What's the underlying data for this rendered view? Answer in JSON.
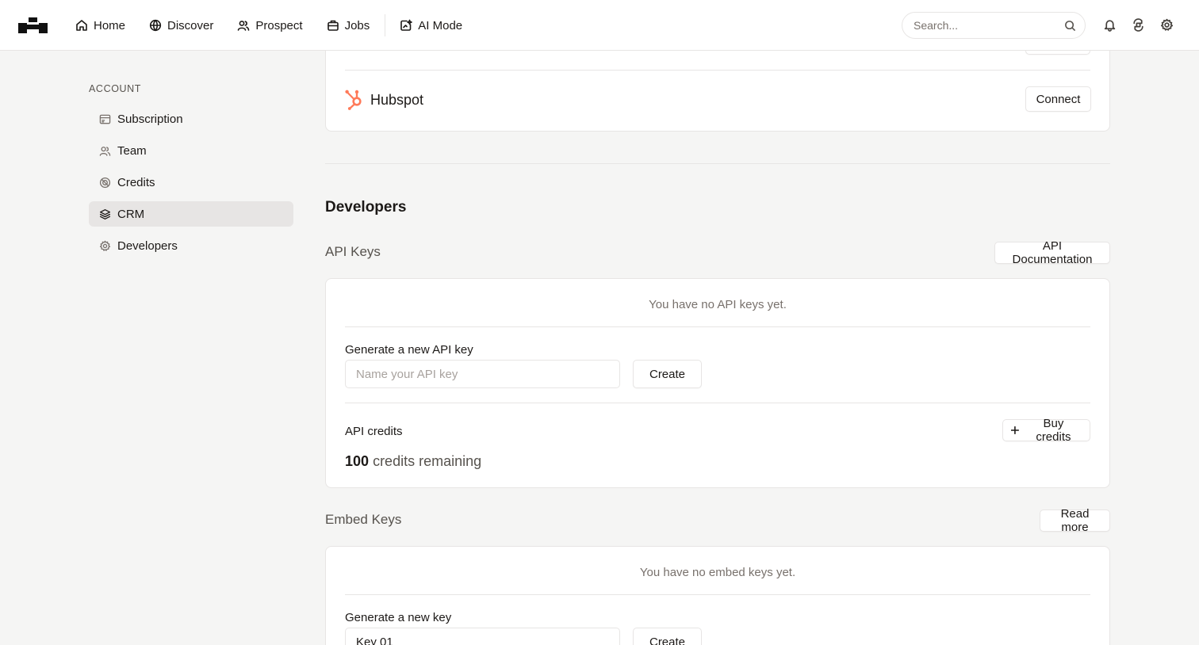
{
  "nav": {
    "items": [
      {
        "label": "Home",
        "icon": "home-icon"
      },
      {
        "label": "Discover",
        "icon": "globe-icon"
      },
      {
        "label": "Prospect",
        "icon": "users-icon"
      },
      {
        "label": "Jobs",
        "icon": "briefcase-icon"
      },
      {
        "label": "AI Mode",
        "icon": "ai-sparkle-icon"
      }
    ],
    "search_placeholder": "Search..."
  },
  "sidebar": {
    "section_title": "ACCOUNT",
    "items": [
      {
        "label": "Subscription",
        "icon": "card-icon"
      },
      {
        "label": "Team",
        "icon": "team-icon"
      },
      {
        "label": "Credits",
        "icon": "coin-icon"
      },
      {
        "label": "CRM",
        "icon": "layers-icon",
        "active": true
      },
      {
        "label": "Developers",
        "icon": "gear-icon"
      }
    ]
  },
  "crm": {
    "integrations": [
      {
        "name": "Hubspot",
        "icon": "hubspot-icon",
        "action": "Connect"
      }
    ]
  },
  "developers": {
    "title": "Developers",
    "api_keys": {
      "title": "API Keys",
      "docs_button": "API Documentation",
      "empty_message": "You have no API keys yet.",
      "generate_label": "Generate a new API key",
      "input_placeholder": "Name your API key",
      "create_button": "Create",
      "credits_label": "API credits",
      "buy_button": "Buy credits",
      "credits_value": "100",
      "credits_suffix": "credits remaining"
    },
    "embed_keys": {
      "title": "Embed Keys",
      "read_more_button": "Read more",
      "empty_message": "You have no embed keys yet.",
      "generate_label": "Generate a new key",
      "input_value": "Key 01",
      "create_button": "Create"
    }
  },
  "colors": {
    "accent_hubspot": "#ff7a59",
    "background": "#f5f5f4",
    "border": "#e7e5e4",
    "active_bg": "#e7e5e4"
  }
}
